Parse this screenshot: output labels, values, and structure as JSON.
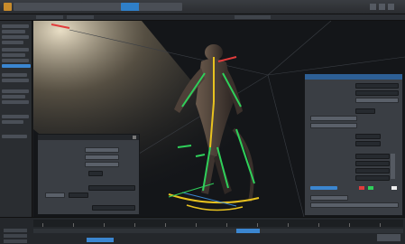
{
  "menu": {
    "title": "",
    "tabs": [
      "",
      "",
      "",
      "",
      "",
      "",
      "",
      "",
      ""
    ],
    "active_tab": 6
  },
  "left_panel": {
    "items": [
      "",
      "",
      "",
      "",
      "",
      "",
      "",
      "",
      "",
      "",
      "",
      "",
      "",
      "",
      "",
      ""
    ],
    "highlight_index": 7
  },
  "viewport": {
    "view_label": ""
  },
  "floating_panel": {
    "title": "",
    "fields": [
      "",
      "",
      "",
      "",
      "",
      ""
    ],
    "bottom_buttons": [
      "",
      ""
    ]
  },
  "right_panel": {
    "title": "",
    "rows": [
      "",
      "",
      "",
      "",
      "",
      "",
      "",
      "",
      "",
      "",
      "",
      "",
      "",
      ""
    ]
  },
  "timeline": {
    "frame_labels": [
      "",
      "",
      "",
      "",
      "",
      "",
      "",
      "",
      "",
      "",
      "",
      ""
    ],
    "controls": [
      "",
      "",
      "",
      "",
      ""
    ]
  },
  "colors": {
    "accent": "#3b86d0",
    "bone_green": "#2fd05a",
    "bone_red": "#e23c3c",
    "bone_yellow": "#e8c21f"
  }
}
